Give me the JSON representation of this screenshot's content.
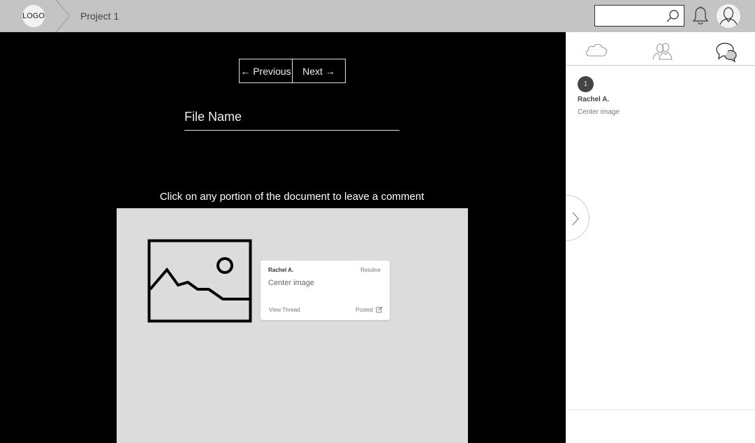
{
  "header": {
    "logo": "LOGO",
    "project": "Project 1",
    "search": {
      "value": "",
      "placeholder": ""
    }
  },
  "pager": {
    "previous": "← Previous",
    "next": "Next →"
  },
  "file": {
    "name": "File Name"
  },
  "hint": "Click on any portion of the document  to leave a comment",
  "document": {
    "comment_card": {
      "author": "Rachel A.",
      "resolve": "Resolve",
      "text": "Center image",
      "view_thread": "View Thread",
      "status": "Posted"
    }
  },
  "panel": {
    "tabs": [
      "cloud-icon",
      "users-icon",
      "comments-icon"
    ],
    "active_tab": "comments-icon",
    "comments": [
      {
        "number": "1",
        "author": "Rachel A.",
        "text": "Center image"
      }
    ]
  },
  "colors": {
    "topbar": "#c4c4c4",
    "canvas": "#000000",
    "document": "#dcdcdc",
    "badge": "#444444"
  }
}
